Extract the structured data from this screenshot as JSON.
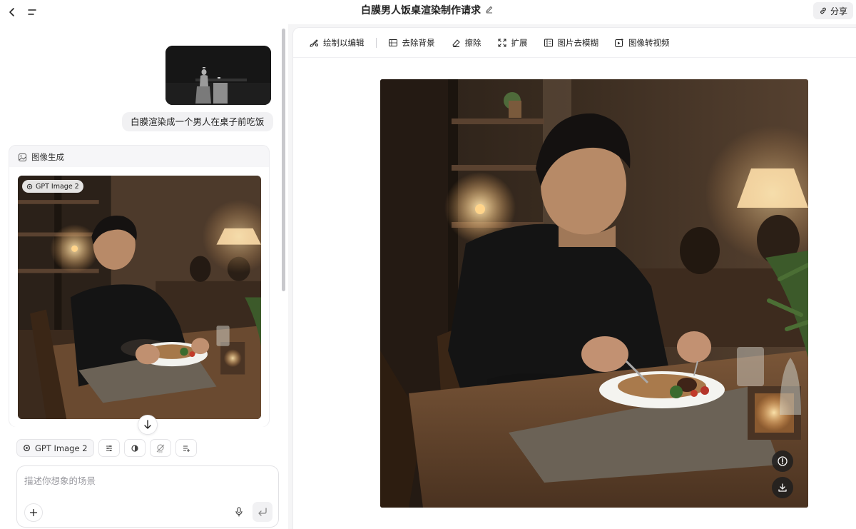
{
  "header": {
    "title": "白膜男人饭桌渲染制作请求",
    "share_label": "分享"
  },
  "chat": {
    "user_message": "白膜渲染成一个男人在桌子前吃饭",
    "gen_card_title": "图像生成",
    "model_badge": "GPT Image 2"
  },
  "composer": {
    "model_label": "GPT Image 2",
    "placeholder": "描述你想象的场景",
    "value": ""
  },
  "toolbar": {
    "items": [
      "绘制以编辑",
      "去除背景",
      "擦除",
      "扩展",
      "图片去模糊",
      "图像转视频"
    ]
  },
  "colors": {
    "accent": "#222222",
    "panel_bg": "#f5f5f6",
    "card_bg": "#f6f6f8"
  },
  "icons": [
    "back-icon",
    "menu-icon",
    "edit-icon",
    "share-icon",
    "image-gen-icon",
    "arrow-down-icon",
    "plus-icon",
    "mic-icon",
    "send-icon",
    "info-icon",
    "download-icon"
  ]
}
